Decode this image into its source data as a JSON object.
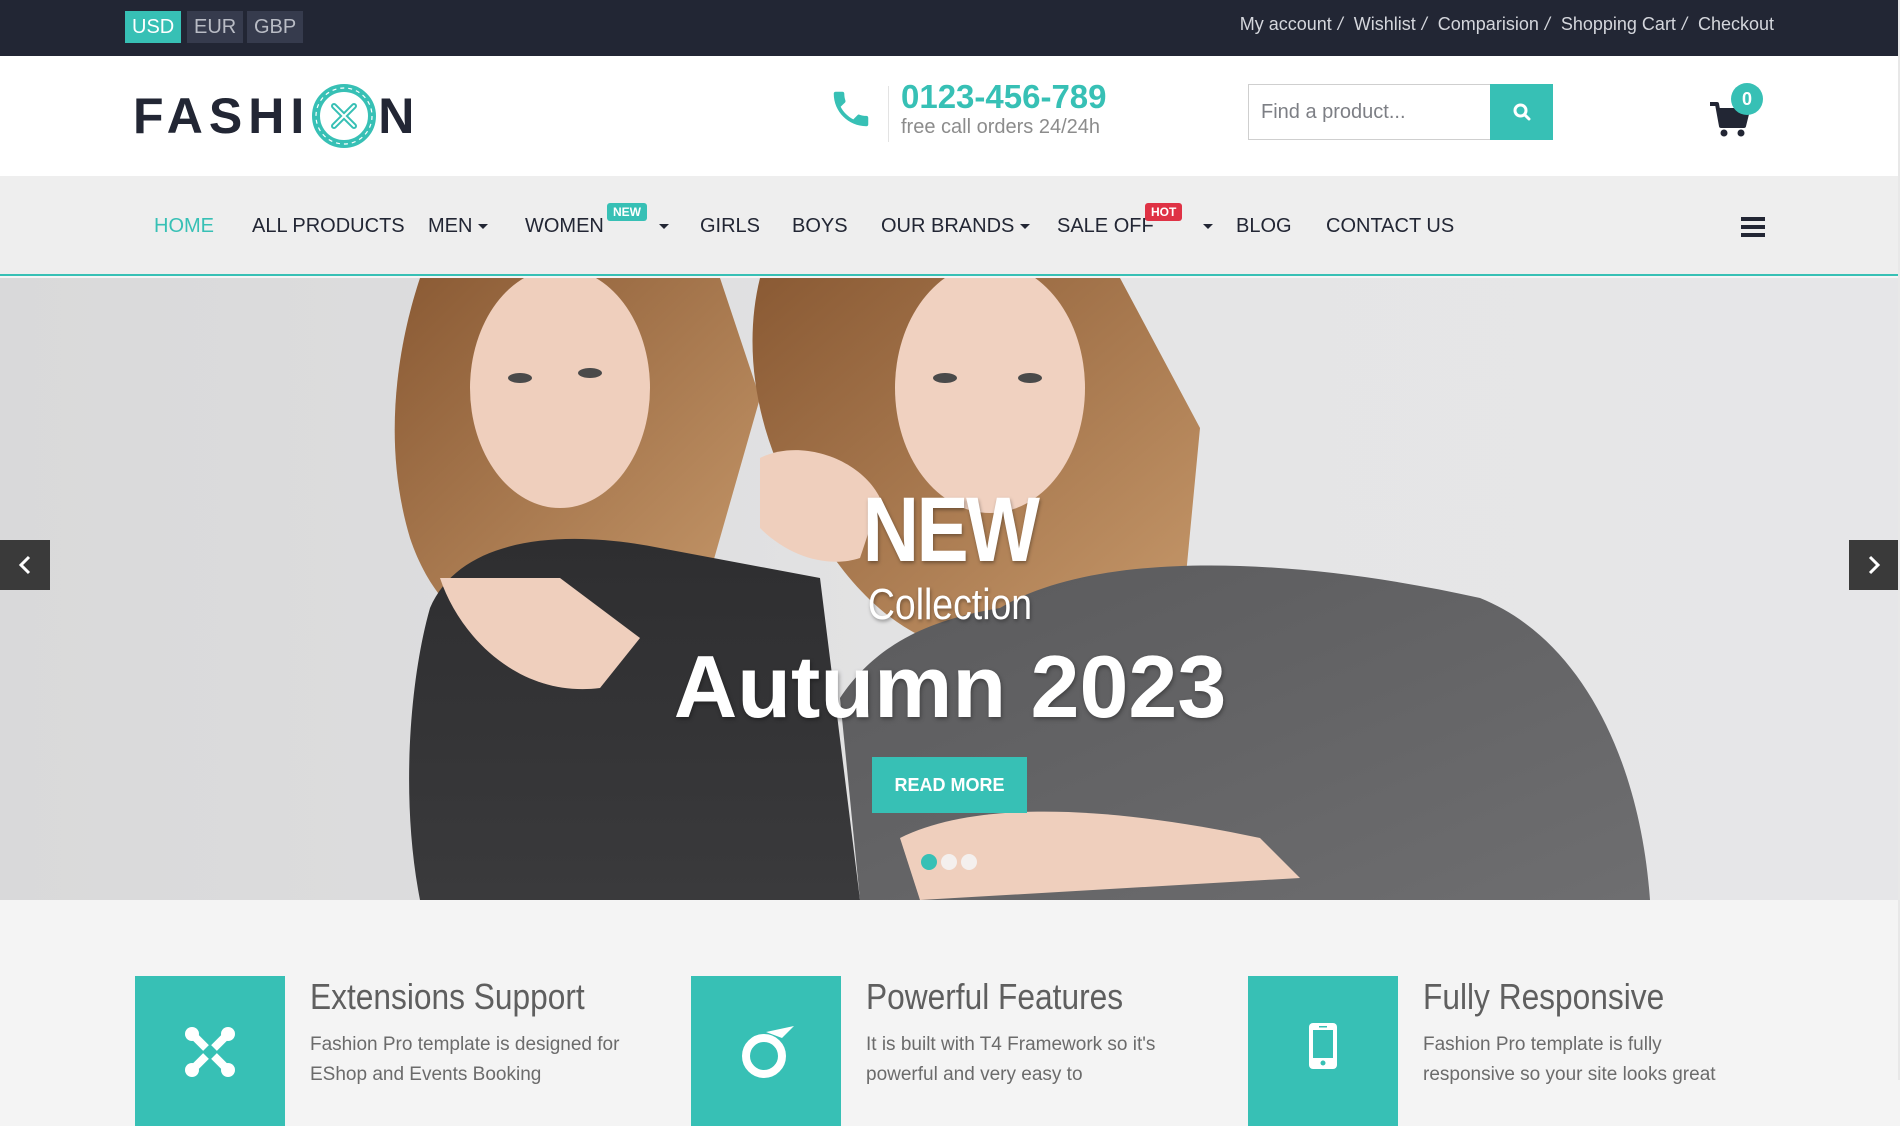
{
  "topbar": {
    "currencies": [
      {
        "label": "USD",
        "active": true
      },
      {
        "label": "EUR",
        "active": false
      },
      {
        "label": "GBP",
        "active": false
      }
    ],
    "links": [
      "My account",
      "Wishlist",
      "Comparision",
      "Shopping Cart",
      "Checkout"
    ],
    "separator": "/"
  },
  "header": {
    "logo": {
      "left": "FASHI",
      "right": "N",
      "alt": "FASHION"
    },
    "phone": {
      "icon": "phone-icon",
      "number": "0123-456-789",
      "subtext": "free call orders 24/24h"
    },
    "search": {
      "placeholder": "Find a product...",
      "value": "",
      "button_icon": "search-icon"
    },
    "cart": {
      "icon": "shopping-cart-icon",
      "count": "0"
    }
  },
  "nav": {
    "items": [
      {
        "label": "HOME",
        "active": true,
        "dropdown": false,
        "badge": null
      },
      {
        "label": "ALL PRODUCTS",
        "active": false,
        "dropdown": false,
        "badge": null
      },
      {
        "label": "MEN",
        "active": false,
        "dropdown": true,
        "badge": null
      },
      {
        "label": "WOMEN",
        "active": false,
        "dropdown": true,
        "badge": "NEW"
      },
      {
        "label": "GIRLS",
        "active": false,
        "dropdown": false,
        "badge": null
      },
      {
        "label": "BOYS",
        "active": false,
        "dropdown": false,
        "badge": null
      },
      {
        "label": "OUR BRANDS",
        "active": false,
        "dropdown": true,
        "badge": null
      },
      {
        "label": "SALE OFF",
        "active": false,
        "dropdown": true,
        "badge": "HOT"
      },
      {
        "label": "BLOG",
        "active": false,
        "dropdown": false,
        "badge": null
      },
      {
        "label": "CONTACT US",
        "active": false,
        "dropdown": false,
        "badge": null
      }
    ],
    "menu_icon": "hamburger-menu-icon"
  },
  "hero": {
    "line1": "NEW",
    "line2": "Collection",
    "line3": "Autumn 2023",
    "button": "READ MORE",
    "slides_total": 3,
    "active_slide": 1,
    "prev_icon": "chevron-left-icon",
    "next_icon": "chevron-right-icon"
  },
  "features": [
    {
      "icon": "joomla-icon",
      "title": "Extensions Support",
      "text": "Fashion Pro template is designed for EShop and Events Booking"
    },
    {
      "icon": "t4-framework-icon",
      "title": "Powerful Features",
      "text": "It is built with T4 Framework so it's powerful and very easy to"
    },
    {
      "icon": "mobile-phone-icon",
      "title": "Fully Responsive",
      "text": "Fashion Pro template is fully responsive so your site looks great"
    }
  ],
  "colors": {
    "accent": "#37c0b5",
    "dark": "#222634",
    "hot": "#df3245",
    "nav_bg": "#eeeeee"
  }
}
